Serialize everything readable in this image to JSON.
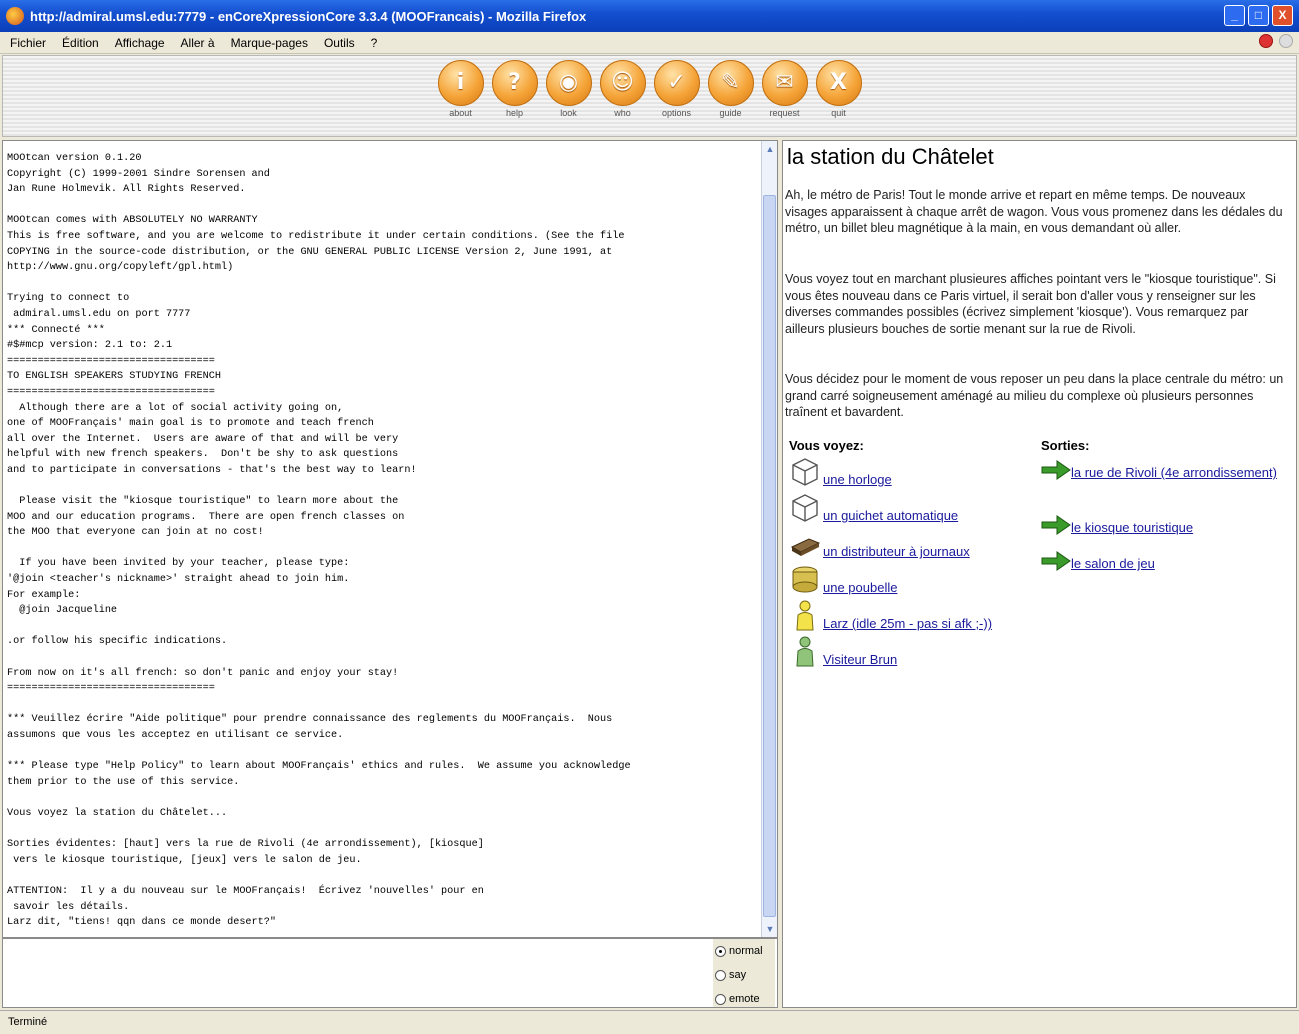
{
  "window": {
    "title": "http://admiral.umsl.edu:7779 - enCoreXpressionCore 3.3.4 (MOOFrancais) - Mozilla Firefox",
    "controls": [
      "_",
      "□",
      "X"
    ]
  },
  "menu": [
    "Fichier",
    "Édition",
    "Affichage",
    "Aller à",
    "Marque-pages",
    "Outils",
    "?"
  ],
  "toolbar": [
    {
      "label": "about",
      "glyph": "i"
    },
    {
      "label": "help",
      "glyph": "?"
    },
    {
      "label": "look",
      "glyph": "◉"
    },
    {
      "label": "who",
      "glyph": "☺"
    },
    {
      "label": "options",
      "glyph": "✓"
    },
    {
      "label": "guide",
      "glyph": "✎"
    },
    {
      "label": "request",
      "glyph": "✉"
    },
    {
      "label": "quit",
      "glyph": "X"
    }
  ],
  "console": {
    "text": "MOOtcan version 0.1.20\nCopyright (C) 1999-2001 Sindre Sorensen and\nJan Rune Holmevik. All Rights Reserved.\n\nMOOtcan comes with ABSOLUTELY NO WARRANTY\nThis is free software, and you are welcome to redistribute it under certain conditions. (See the file\nCOPYING in the source-code distribution, or the GNU GENERAL PUBLIC LICENSE Version 2, June 1991, at\nhttp://www.gnu.org/copyleft/gpl.html)\n\nTrying to connect to\n admiral.umsl.edu on port 7777\n*** Connecté ***\n#$#mcp version: 2.1 to: 2.1\n==================================\nTO ENGLISH SPEAKERS STUDYING FRENCH\n==================================\n  Although there are a lot of social activity going on,\none of MOOFrançais' main goal is to promote and teach french\nall over the Internet.  Users are aware of that and will be very\nhelpful with new french speakers.  Don't be shy to ask questions\nand to participate in conversations - that's the best way to learn!\n\n  Please visit the \"kiosque touristique\" to learn more about the\nMOO and our education programs.  There are open french classes on\nthe MOO that everyone can join at no cost!\n\n  If you have been invited by your teacher, please type:\n'@join <teacher's nickname>' straight ahead to join him.\nFor example:\n  @join Jacqueline\n\n.or follow his specific indications.\n\nFrom now on it's all french: so don't panic and enjoy your stay!\n==================================\n\n*** Veuillez écrire \"Aide politique\" pour prendre connaissance des reglements du MOOFrançais.  Nous\nassumons que vous les acceptez en utilisant ce service.\n\n*** Please type \"Help Policy\" to learn about MOOFrançais' ethics and rules.  We assume you acknowledge\nthem prior to the use of this service.\n\nVous voyez la station du Châtelet...\n\nSorties évidentes: [haut] vers la rue de Rivoli (4e arrondissement), [kiosque]\n vers le kiosque touristique, [jeux] vers le salon de jeu.\n\nATTENTION:  Il y a du nouveau sur le MOOFrançais!  Écrivez 'nouvelles' pour en\n savoir les détails.\nLarz dit, \"tiens! qqn dans ce monde desert?\""
  },
  "input": {
    "value": "",
    "modes": [
      {
        "label": "normal",
        "selected": true
      },
      {
        "label": "say",
        "selected": false
      },
      {
        "label": "emote",
        "selected": false
      }
    ]
  },
  "room": {
    "title": "la station du Châtelet",
    "paragraphs": [
      "Ah, le métro de Paris!  Tout le monde arrive et repart en même temps.  De nouveaux visages apparaissent à chaque arrêt de wagon.  Vous vous promenez dans les dédales du métro, un billet bleu magnétique à la main, en vous demandant où aller.",
      "Vous voyez tout en marchant plusieures affiches pointant vers le \"kiosque touristique\".  Si vous êtes nouveau dans ce Paris virtuel, il serait bon d'aller vous y renseigner sur les diverses commandes possibles (écrivez simplement 'kiosque').  Vous remarquez par ailleurs plusieurs bouches de sortie menant sur la rue de Rivoli.",
      "Vous décidez pour le moment de vous reposer un peu dans la place centrale du métro: un grand carré soigneusement aménagé au milieu du complexe où plusieurs personnes traînent et bavardent."
    ],
    "see_heading": "Vous voyez:",
    "exits_heading": "Sorties:",
    "objects": [
      {
        "label": "une horloge",
        "icon": "cube-icon"
      },
      {
        "label": "un guichet automatique",
        "icon": "cube-icon"
      },
      {
        "label": "un distributeur à journaux",
        "icon": "newspaper-icon"
      },
      {
        "label": "une poubelle",
        "icon": "trash-can-icon"
      },
      {
        "label": "Larz (idle 25m - pas si afk ;-))",
        "icon": "person-yellow-icon"
      },
      {
        "label": "Visiteur Brun",
        "icon": "person-green-icon"
      }
    ],
    "exits": [
      {
        "label": "la rue de Rivoli (4e arrondissement)"
      },
      {
        "label": "le kiosque touristique"
      },
      {
        "label": "le salon de jeu"
      }
    ]
  },
  "status": "Terminé"
}
